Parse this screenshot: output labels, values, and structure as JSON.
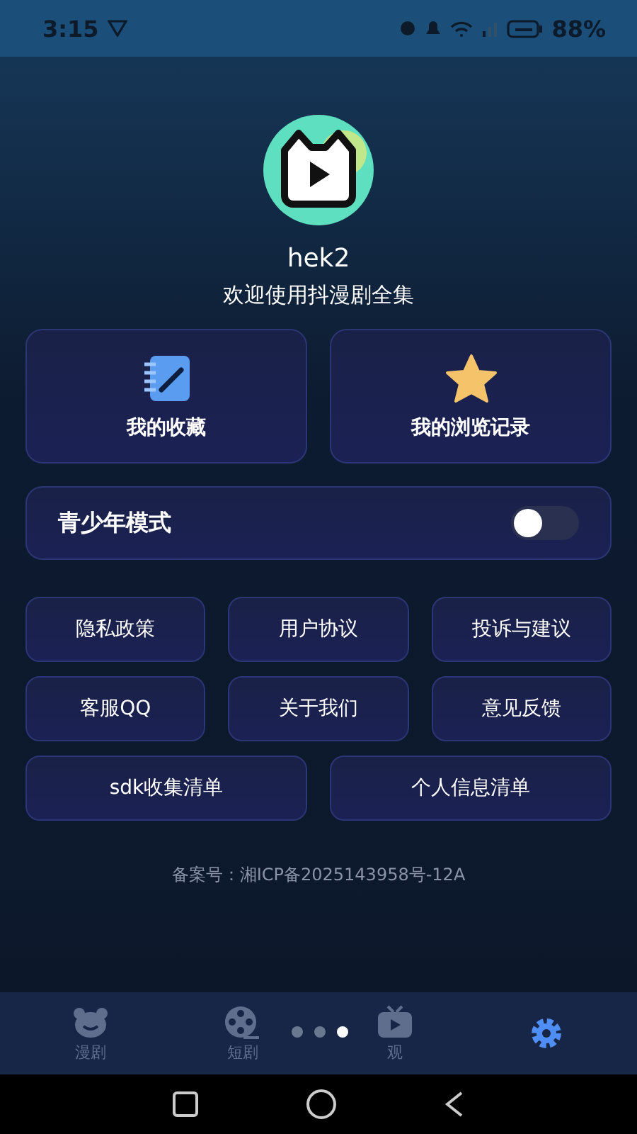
{
  "status_bar": {
    "time": "3:15",
    "battery": "88%"
  },
  "profile": {
    "name": "hek2",
    "welcome": "欢迎使用抖漫剧全集"
  },
  "shortcuts": [
    {
      "label": "我的收藏",
      "kind": "notebook"
    },
    {
      "label": "我的浏览记录",
      "kind": "star"
    }
  ],
  "teen_mode": {
    "label": "青少年模式",
    "on": false
  },
  "links": [
    {
      "label": "隐私政策"
    },
    {
      "label": "用户协议"
    },
    {
      "label": "投诉与建议"
    },
    {
      "label": "客服QQ"
    },
    {
      "label": "关于我们"
    },
    {
      "label": "意见反馈"
    }
  ],
  "wide_links": [
    {
      "label": "sdk收集清单"
    },
    {
      "label": "个人信息清单"
    }
  ],
  "icp": "备案号：湘ICP备2025143958号-12A",
  "page_dots": [
    {
      "selected": false
    },
    {
      "selected": false
    },
    {
      "selected": true
    }
  ],
  "tabs": [
    {
      "label": "漫剧",
      "kind": "bear",
      "selected": false
    },
    {
      "label": "短剧",
      "kind": "reel",
      "selected": false
    },
    {
      "label": "观",
      "kind": "tv",
      "selected": false
    },
    {
      "kind": "gear",
      "selected": true
    }
  ]
}
